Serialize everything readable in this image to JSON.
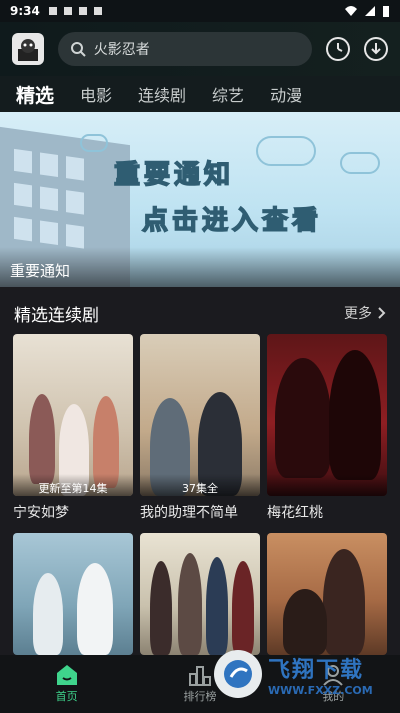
{
  "status_bar": {
    "time": "9:34"
  },
  "search": {
    "placeholder": "火影忍者"
  },
  "tabs": [
    {
      "label": "精选",
      "active": true
    },
    {
      "label": "电影"
    },
    {
      "label": "连续剧"
    },
    {
      "label": "综艺"
    },
    {
      "label": "动漫"
    }
  ],
  "banner": {
    "line1": "重要通知",
    "line2": "点击进入查看",
    "caption": "重要通知"
  },
  "section": {
    "title": "精选连续剧",
    "more": "更多"
  },
  "shows": [
    {
      "title": "宁安如梦",
      "badge": "更新至第14集"
    },
    {
      "title": "我的助理不简单",
      "badge": "37集全"
    },
    {
      "title": "梅花红桃",
      "badge": ""
    },
    {
      "title": "",
      "badge": ""
    },
    {
      "title": "",
      "badge": ""
    },
    {
      "title": "",
      "badge": ""
    }
  ],
  "bottom_nav": [
    {
      "label": "首页",
      "active": true
    },
    {
      "label": "排行榜"
    },
    {
      "label": "我的"
    }
  ],
  "watermark": {
    "name": "飞翔下载",
    "url": "WWW.FXXZ.COM"
  },
  "colors": {
    "accent": "#3fd48c",
    "background": "#1b1b1f"
  }
}
